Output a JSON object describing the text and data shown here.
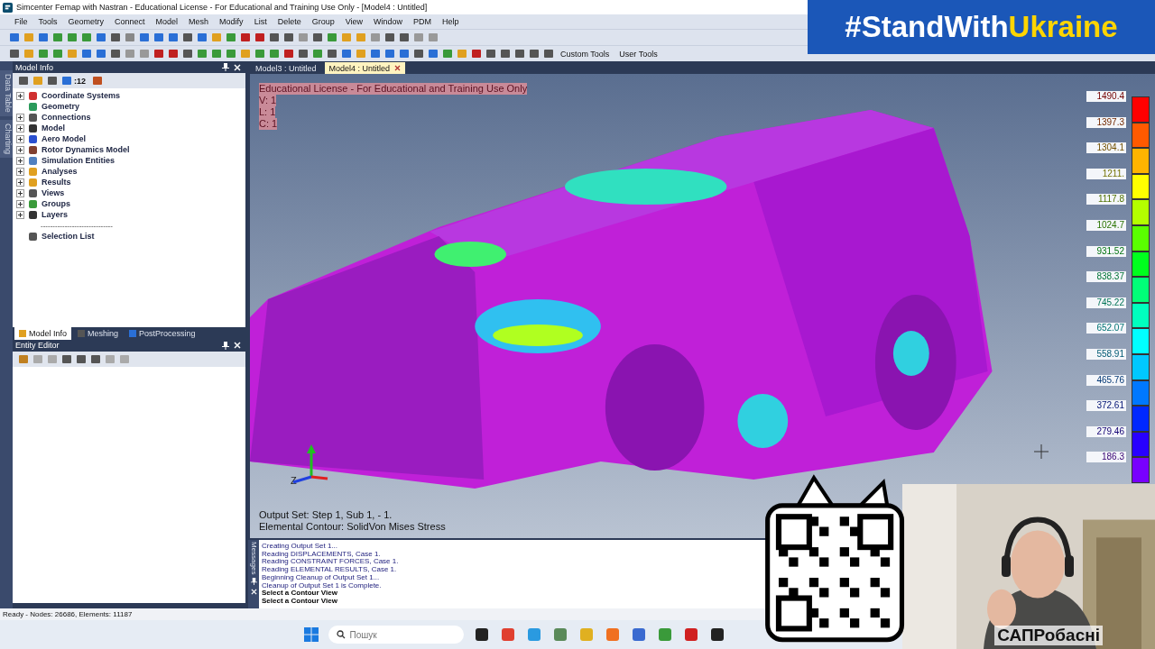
{
  "window": {
    "title": "Simcenter Femap with Nastran - Educational License - For Educational and Training Use Only - [Model4 : Untitled]"
  },
  "menu": [
    "File",
    "Tools",
    "Geometry",
    "Connect",
    "Model",
    "Mesh",
    "Modify",
    "List",
    "Delete",
    "Group",
    "View",
    "Window",
    "PDM",
    "Help"
  ],
  "toolbar": {
    "text_buttons": [
      "Custom Tools",
      "User Tools"
    ]
  },
  "side_tabs": [
    {
      "label": "Data Table",
      "selected": false
    },
    {
      "label": "Charting",
      "selected": false
    }
  ],
  "model_info": {
    "title": "Model Info",
    "toolbar_count": ":12",
    "tree": [
      {
        "label": "Coordinate Systems",
        "expandable": true,
        "kind": "item"
      },
      {
        "label": "Geometry",
        "expandable": false,
        "kind": "item"
      },
      {
        "label": "Connections",
        "expandable": true,
        "kind": "item"
      },
      {
        "label": "Model",
        "expandable": true,
        "kind": "item"
      },
      {
        "label": "Aero Model",
        "expandable": true,
        "kind": "item"
      },
      {
        "label": "Rotor Dynamics Model",
        "expandable": true,
        "kind": "item"
      },
      {
        "label": "Simulation Entities",
        "expandable": true,
        "kind": "item"
      },
      {
        "label": "Analyses",
        "expandable": true,
        "kind": "item"
      },
      {
        "label": "Results",
        "expandable": true,
        "kind": "item"
      },
      {
        "label": "Views",
        "expandable": true,
        "kind": "item"
      },
      {
        "label": "Groups",
        "expandable": true,
        "kind": "item"
      },
      {
        "label": "Layers",
        "expandable": true,
        "kind": "item"
      },
      {
        "label": "------------------------------",
        "expandable": false,
        "kind": "separator"
      },
      {
        "label": "Selection List",
        "expandable": false,
        "kind": "item"
      }
    ],
    "tabs": [
      {
        "label": "Model Info",
        "selected": true
      },
      {
        "label": "Meshing",
        "selected": false
      },
      {
        "label": "PostProcessing",
        "selected": false
      }
    ]
  },
  "entity_editor": {
    "title": "Entity Editor"
  },
  "model_tabs": [
    {
      "label": "Model3 : Untitled",
      "selected": false
    },
    {
      "label": "Model4 : Untitled",
      "selected": true
    }
  ],
  "viewport": {
    "license_lines": [
      "Educational License - For Educational and Training Use Only",
      "V: 1",
      "L: 1",
      "C: 1"
    ],
    "output_lines": [
      "Output Set: Step 1, Sub 1, - 1.",
      "Elemental Contour: SolidVon Mises Stress"
    ],
    "axis_label": "Z",
    "legend": [
      {
        "value": "1490.4",
        "color": "#ff0000"
      },
      {
        "value": "1397.3",
        "color": "#ff5a00"
      },
      {
        "value": "1304.1",
        "color": "#ffb400"
      },
      {
        "value": "1211.",
        "color": "#ffff00"
      },
      {
        "value": "1117.8",
        "color": "#b4ff00"
      },
      {
        "value": "1024.7",
        "color": "#5aff00"
      },
      {
        "value": "931.52",
        "color": "#00ff1e"
      },
      {
        "value": "838.37",
        "color": "#00ff78"
      },
      {
        "value": "745.22",
        "color": "#00ffbe"
      },
      {
        "value": "652.07",
        "color": "#00ffff"
      },
      {
        "value": "558.91",
        "color": "#00c8ff"
      },
      {
        "value": "465.76",
        "color": "#0078ff"
      },
      {
        "value": "372.61",
        "color": "#0028ff"
      },
      {
        "value": "279.46",
        "color": "#2800ff"
      },
      {
        "value": "186.3",
        "color": "#7800ff"
      }
    ]
  },
  "messages": {
    "title": "Messages",
    "lines": [
      {
        "text": "Creating Output Set 1...",
        "kind": "log"
      },
      {
        "text": "Reading DISPLACEMENTS, Case 1.",
        "kind": "log"
      },
      {
        "text": "Reading CONSTRAINT FORCES, Case 1.",
        "kind": "log"
      },
      {
        "text": "Reading ELEMENTAL RESULTS, Case 1.",
        "kind": "log"
      },
      {
        "text": "Beginning Cleanup of Output Set 1...",
        "kind": "log"
      },
      {
        "text": "Cleanup of Output Set 1 is Complete.",
        "kind": "log"
      },
      {
        "text": "Select a Contour View",
        "kind": "prompt"
      },
      {
        "text": "Select a Contour View",
        "kind": "prompt"
      }
    ]
  },
  "status_bar": "Ready - Nodes: 26686, Elements: 11187",
  "taskbar": {
    "search": {
      "placeholder": "Пошук"
    }
  },
  "overlay": {
    "banner": {
      "lead": "#StandWith",
      "accent": "Ukraine"
    },
    "channel_name": "САПРобасні"
  }
}
